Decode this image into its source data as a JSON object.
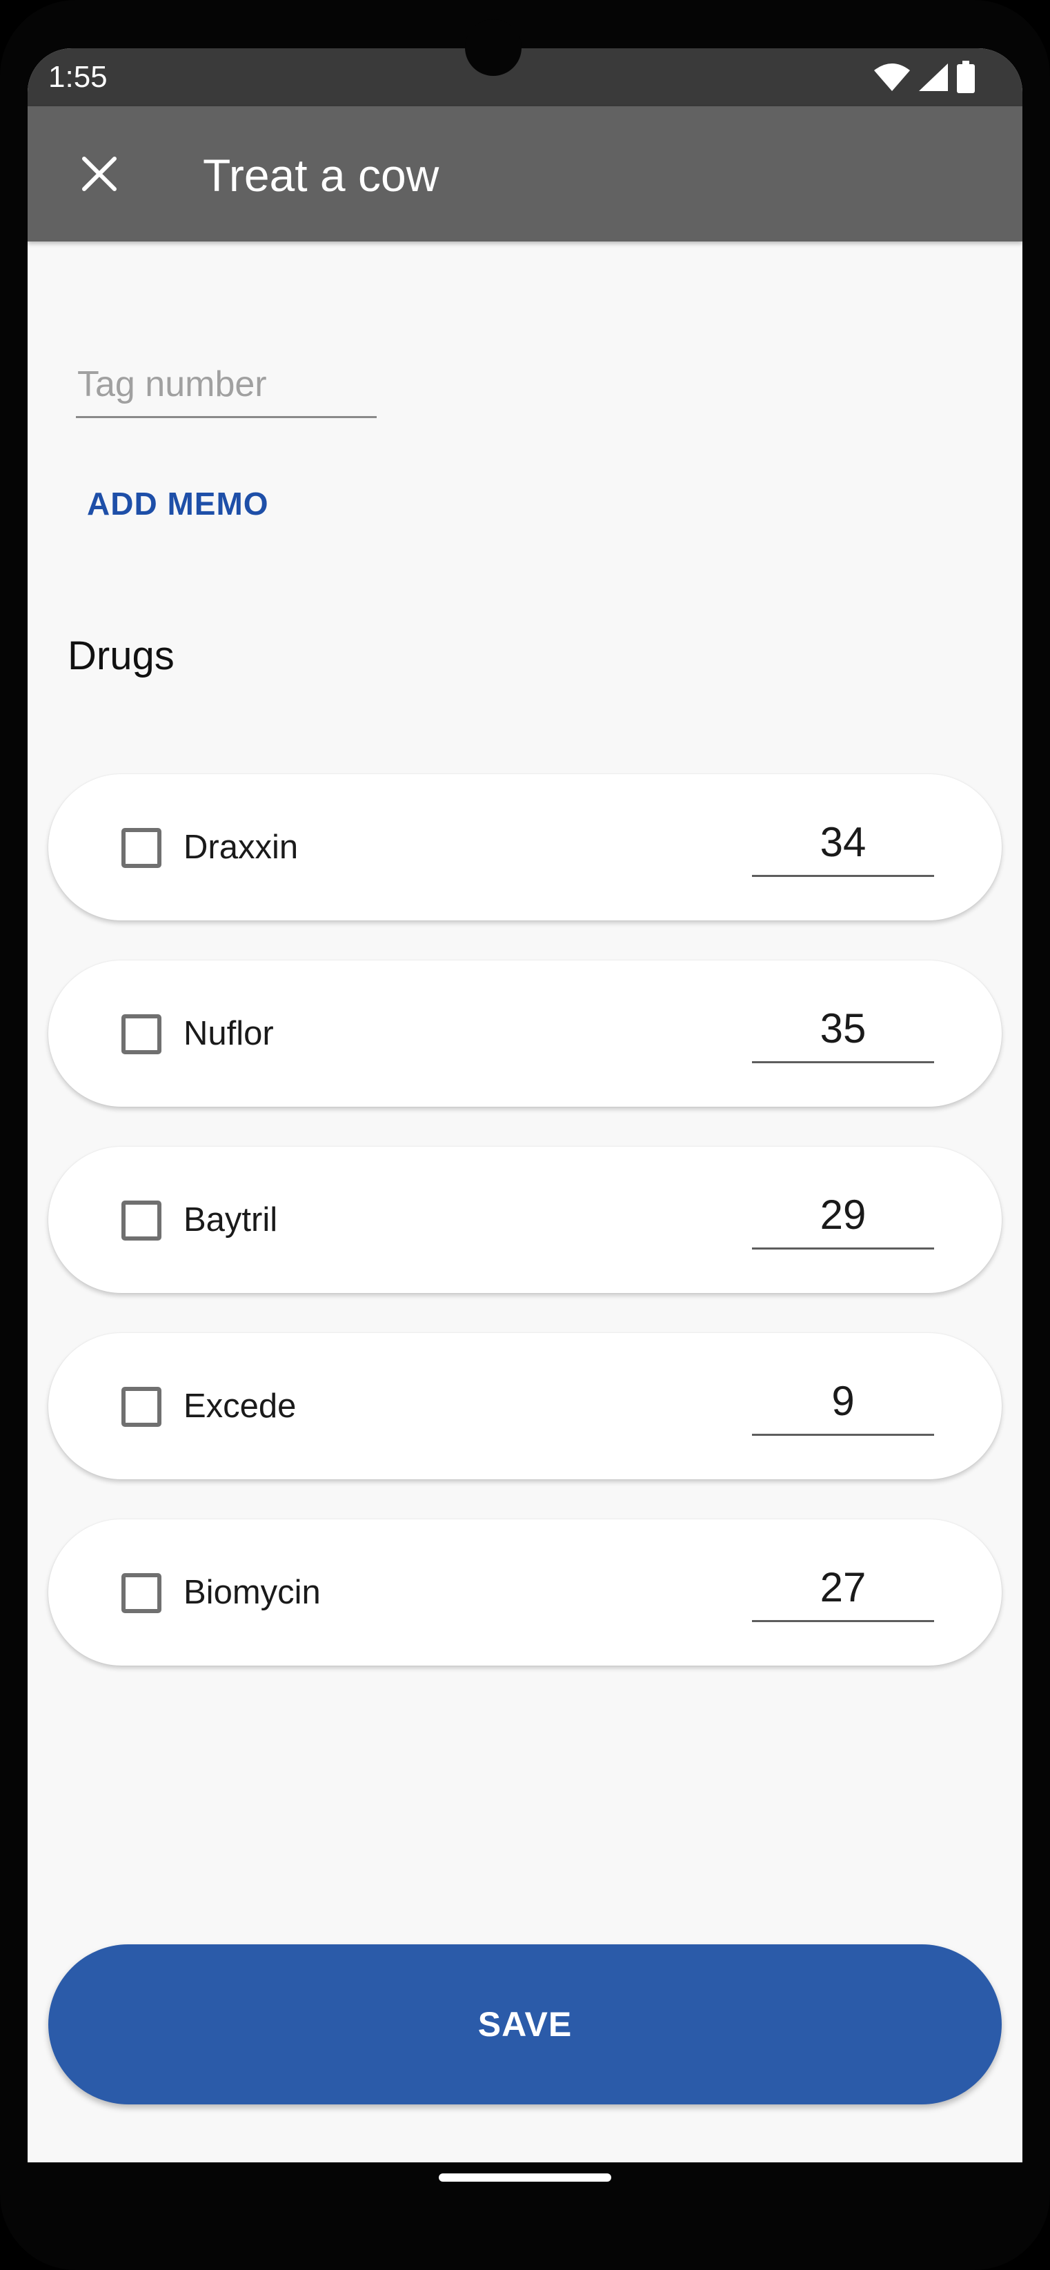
{
  "status_bar": {
    "time": "1:55",
    "icons": [
      "wifi-icon",
      "signal-icon",
      "battery-icon"
    ]
  },
  "app_bar": {
    "close_icon": "close-icon",
    "title": "Treat a cow"
  },
  "form": {
    "tag_placeholder": "Tag number",
    "tag_value": "",
    "add_memo_label": "ADD MEMO"
  },
  "drugs": {
    "title": "Drugs",
    "items": [
      {
        "name": "Draxxin",
        "quantity": "34",
        "checked": false
      },
      {
        "name": "Nuflor",
        "quantity": "35",
        "checked": false
      },
      {
        "name": "Baytril",
        "quantity": "29",
        "checked": false
      },
      {
        "name": "Excede",
        "quantity": "9",
        "checked": false
      },
      {
        "name": "Biomycin",
        "quantity": "27",
        "checked": false
      }
    ]
  },
  "actions": {
    "save_label": "SAVE"
  },
  "colors": {
    "app_bar": "#626262",
    "status_bar": "#3a3a3a",
    "accent": "#2b5ba9",
    "link": "#1e4fa8",
    "background": "#f8f8f8"
  }
}
